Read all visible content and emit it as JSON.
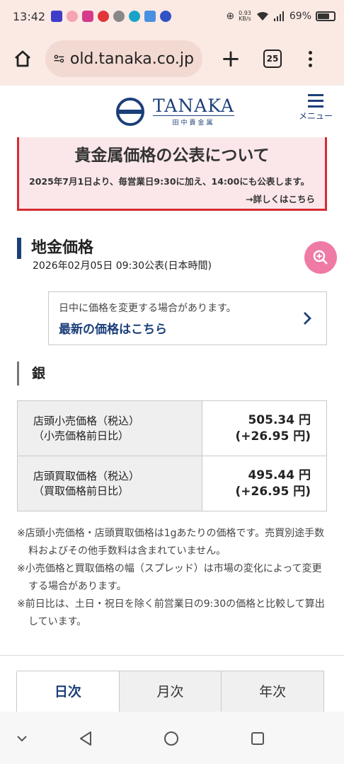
{
  "status": {
    "time": "13:42",
    "net_speed_value": "0.93",
    "net_speed_unit": "KB/s",
    "battery": "69%"
  },
  "browser": {
    "url": "old.tanaka.co.jp",
    "tab_count": "25"
  },
  "site": {
    "logo_en": "TANAKA",
    "logo_jp": "田中貴金属",
    "menu_label": "メニュー"
  },
  "notice": {
    "title": "貴金属価格の公表について",
    "body": "2025年7月1日より、毎営業日9:30に加え、14:00にも公表します。",
    "more_link": "→詳しくはこちら"
  },
  "section": {
    "title": "地金価格",
    "date": "2026年02月05日 09:30公表(日本時間)"
  },
  "info": {
    "hint": "日中に価格を変更する場合があります。",
    "link": "最新の価格はこちら"
  },
  "metal": "銀",
  "prices": {
    "retail_label_1": "店頭小売価格（税込）",
    "retail_label_2": "（小売価格前日比）",
    "retail_value": "505.34 円",
    "retail_change": "(+26.95 円)",
    "buy_label_1": "店頭買取価格（税込）",
    "buy_label_2": "（買取価格前日比）",
    "buy_value": "495.44 円",
    "buy_change": "(+26.95 円)"
  },
  "notes": [
    "※店頭小売価格・店頭買取価格は1gあたりの価格です。売買別途手数料およびその他手数料は含まれていません。",
    "※小売価格と買取価格の幅（スプレッド）は市場の変化によって変更する場合があります。",
    "※前日比は、土日・祝日を除く前営業日の9:30の価格と比較して算出しています。"
  ],
  "period_tabs": [
    "日次",
    "月次",
    "年次"
  ],
  "colors": {
    "brand": "#1c3f7a",
    "notice_border": "#d62c32",
    "fab": "#ef7aa6"
  }
}
